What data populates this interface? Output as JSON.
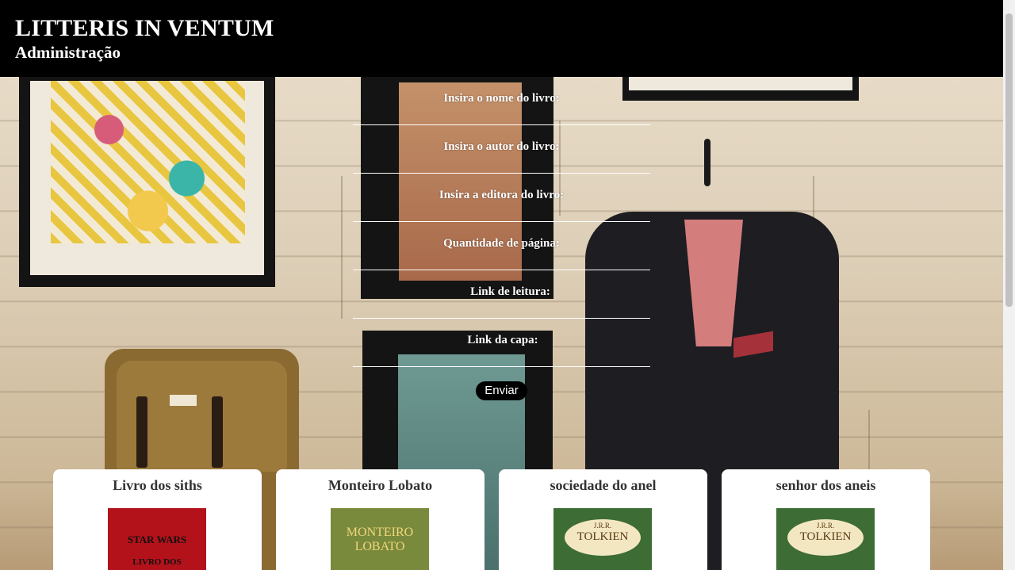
{
  "header": {
    "title": "LITTERIS IN VENTUM",
    "subtitle": "Administração"
  },
  "form": {
    "fields": [
      {
        "label": "Insira o nome do livro:",
        "value": ""
      },
      {
        "label": "Insira o autor do livro:",
        "value": ""
      },
      {
        "label": "Insira a editora do livro:",
        "value": ""
      },
      {
        "label": "Quantidade de página:",
        "value": ""
      },
      {
        "label": "Link de leitura:",
        "value": ""
      },
      {
        "label": "Link da capa:",
        "value": ""
      }
    ],
    "submit_label": "Enviar"
  },
  "books": [
    {
      "title": "Livro dos siths",
      "cover_text_top": "STAR WARS",
      "cover_text_bottom": "LIVRO DOS"
    },
    {
      "title": "Monteiro Lobato",
      "cover_text_top": "MONTEIRO",
      "cover_text_bottom": "LOBATO"
    },
    {
      "title": "sociedade do anel",
      "cover_text_top": "J.R.R.",
      "cover_text_bottom": "TOLKIEN"
    },
    {
      "title": "senhor dos aneis",
      "cover_text_top": "J.R.R.",
      "cover_text_bottom": "TOLKIEN"
    }
  ],
  "colors": {
    "header_bg": "#000000",
    "button_bg": "#000000",
    "card_bg": "#ffffff"
  }
}
